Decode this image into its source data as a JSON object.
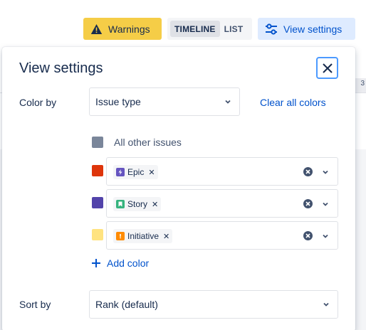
{
  "toolbar": {
    "warnings_label": "Warnings",
    "view_toggle": {
      "options": [
        "TIMELINE",
        "LIST"
      ],
      "selected": "TIMELINE"
    },
    "view_settings_label": "View settings"
  },
  "background": {
    "strip_text": "3"
  },
  "panel": {
    "title": "View settings",
    "color_by": {
      "label": "Color by",
      "value": "Issue type",
      "clear_label": "Clear all colors"
    },
    "other_issues": {
      "label": "All other issues",
      "color": "#7a869a"
    },
    "color_rules": [
      {
        "color": "#de350b",
        "tag": "Epic",
        "icon": "epic-icon",
        "icon_color": "#6554c0"
      },
      {
        "color": "#5243aa",
        "tag": "Story",
        "icon": "story-icon",
        "icon_color": "#36b37e"
      },
      {
        "color": "#ffe380",
        "tag": "Initiative",
        "icon": "initiative-icon",
        "icon_color": "#ff8b00"
      }
    ],
    "add_color_label": "Add color",
    "sort_by": {
      "label": "Sort by",
      "value": "Rank (default)"
    }
  },
  "colors": {
    "warning": "#f5cd47",
    "primary": "#0052cc",
    "primary_light": "#deebff",
    "focus": "#4c9aff"
  }
}
